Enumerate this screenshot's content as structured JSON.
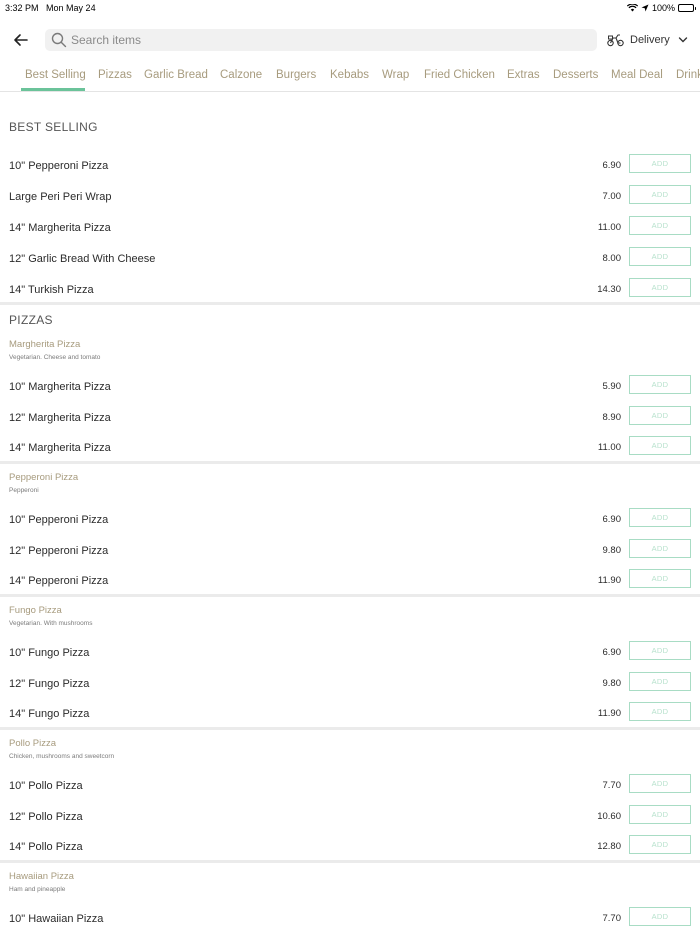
{
  "status": {
    "time": "3:32 PM",
    "date": "Mon May 24",
    "battery": "100%"
  },
  "search": {
    "placeholder": "Search items",
    "value": ""
  },
  "delivery": {
    "label": "Delivery"
  },
  "tabs": [
    {
      "label": "Best Selling",
      "active": true
    },
    {
      "label": "Pizzas"
    },
    {
      "label": "Garlic Bread"
    },
    {
      "label": "Calzone"
    },
    {
      "label": "Burgers"
    },
    {
      "label": "Kebabs"
    },
    {
      "label": "Wrap"
    },
    {
      "label": "Fried Chicken"
    },
    {
      "label": "Extras"
    },
    {
      "label": "Desserts"
    },
    {
      "label": "Meal Deal"
    },
    {
      "label": "Drinks"
    }
  ],
  "add_label": "ADD",
  "best_selling": {
    "title": "BEST SELLING",
    "items": [
      {
        "name": "10\" Pepperoni Pizza",
        "price": "6.90"
      },
      {
        "name": "Large Peri Peri Wrap",
        "price": "7.00"
      },
      {
        "name": "14\" Margherita Pizza",
        "price": "11.00"
      },
      {
        "name": "12\" Garlic Bread With Cheese",
        "price": "8.00"
      },
      {
        "name": "14\" Turkish Pizza",
        "price": "14.30"
      }
    ]
  },
  "pizzas": {
    "title": "PIZZAS",
    "groups": [
      {
        "title": "Margherita Pizza",
        "desc": "Vegetarian. Cheese and tomato",
        "items": [
          {
            "name": "10\" Margherita Pizza",
            "price": "5.90"
          },
          {
            "name": "12\" Margherita Pizza",
            "price": "8.90"
          },
          {
            "name": "14\" Margherita Pizza",
            "price": "11.00"
          }
        ]
      },
      {
        "title": "Pepperoni Pizza",
        "desc": "Pepperoni",
        "items": [
          {
            "name": "10\" Pepperoni Pizza",
            "price": "6.90"
          },
          {
            "name": "12\" Pepperoni Pizza",
            "price": "9.80"
          },
          {
            "name": "14\" Pepperoni Pizza",
            "price": "11.90"
          }
        ]
      },
      {
        "title": "Fungo Pizza",
        "desc": "Vegetarian. With mushrooms",
        "items": [
          {
            "name": "10\" Fungo Pizza",
            "price": "6.90"
          },
          {
            "name": "12\" Fungo Pizza",
            "price": "9.80"
          },
          {
            "name": "14\" Fungo Pizza",
            "price": "11.90"
          }
        ]
      },
      {
        "title": "Pollo Pizza",
        "desc": "Chicken, mushrooms and sweetcorn",
        "items": [
          {
            "name": "10\" Pollo Pizza",
            "price": "7.70"
          },
          {
            "name": "12\" Pollo Pizza",
            "price": "10.60"
          },
          {
            "name": "14\" Pollo Pizza",
            "price": "12.80"
          }
        ]
      },
      {
        "title": "Hawaiian Pizza",
        "desc": "Ham and pineapple",
        "items": [
          {
            "name": "10\" Hawaiian Pizza",
            "price": "7.70"
          }
        ]
      }
    ]
  },
  "colors": {
    "accent": "#6bc39a",
    "category_text": "#a79b7e",
    "add_border": "#a8dcc4"
  }
}
